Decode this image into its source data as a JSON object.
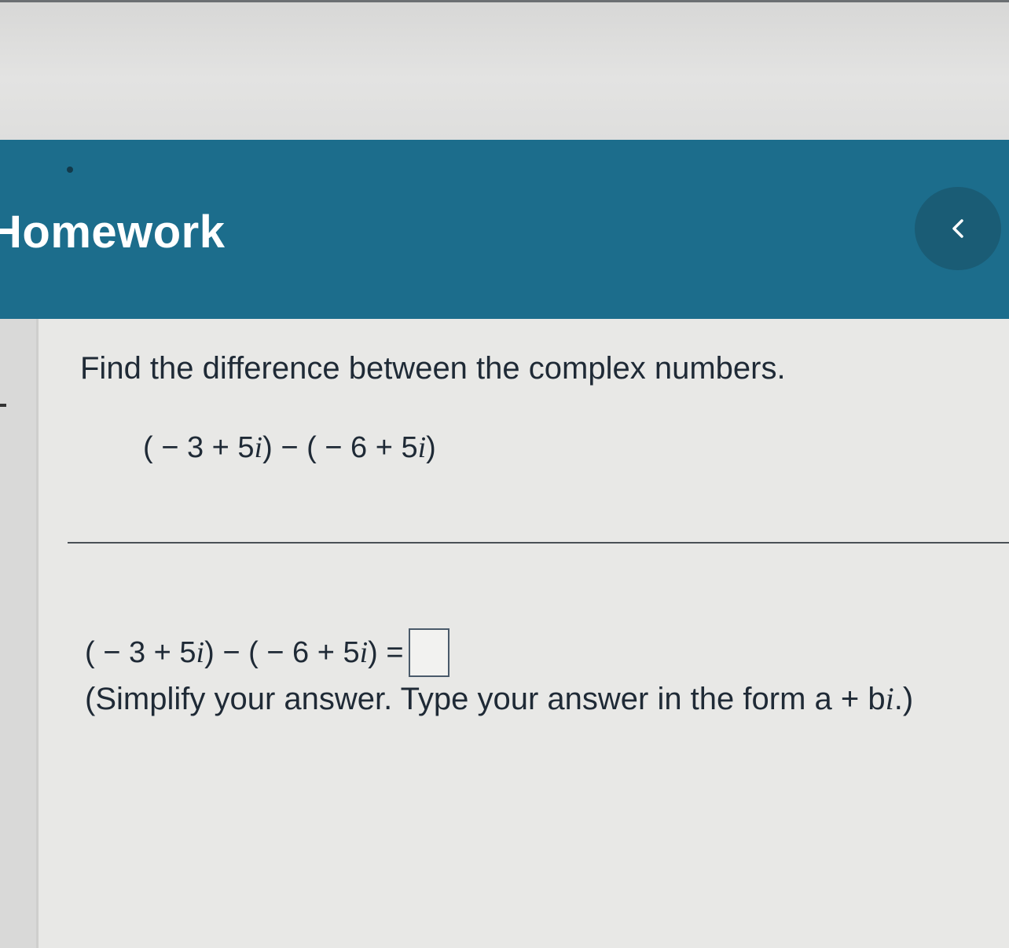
{
  "header": {
    "title": "Homework"
  },
  "question": {
    "prompt": "Find the difference between the complex numbers.",
    "expression": {
      "open1": "( − 3 + 5",
      "i1": "i",
      "mid": ") − ( − 6 + 5",
      "i2": "i",
      "close": ")"
    }
  },
  "answer": {
    "open1": "( − 3 + 5",
    "i1": "i",
    "mid": ") − ( − 6 + 5",
    "i2": "i",
    "close": ") =",
    "value": ""
  },
  "instruction": {
    "text_before": "(Simplify your answer. Type your answer in the form a + b",
    "i": "i",
    "text_after": ".)"
  },
  "colors": {
    "header_band": "#1c6d8c",
    "back_button": "#1a5c75"
  },
  "icons": {
    "back": "chevron-left-icon"
  }
}
